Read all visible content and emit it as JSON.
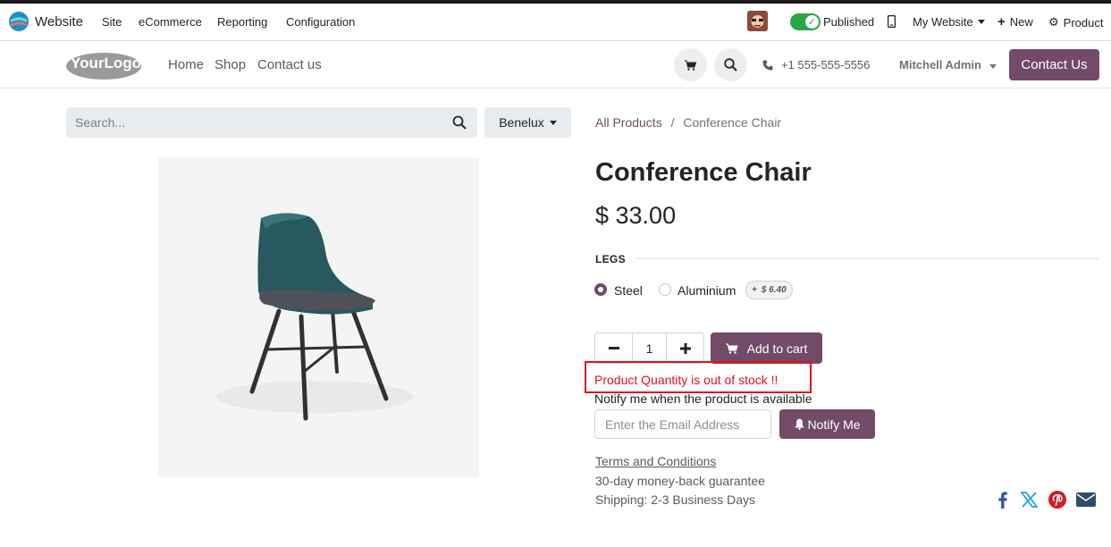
{
  "admin_bar": {
    "app_name": "Website",
    "menus": [
      "Site",
      "eCommerce",
      "Reporting",
      "Configuration"
    ],
    "published_label": "Published",
    "website_label": "My Website",
    "new_label": "New",
    "product_label": "Product"
  },
  "header": {
    "logo_text": "YourLogo",
    "nav": [
      "Home",
      "Shop",
      "Contact us"
    ],
    "phone": "+1 555-555-5556",
    "user": "Mitchell Admin",
    "contact_button": "Contact Us"
  },
  "search": {
    "placeholder": "Search..."
  },
  "pricelist": "Benelux",
  "breadcrumb": {
    "parent": "All Products",
    "separator": "/",
    "current": "Conference Chair"
  },
  "product": {
    "name": "Conference Chair",
    "price": "$ 33.00",
    "attribute_label": "LEGS",
    "options": [
      {
        "label": "Steel",
        "selected": true
      },
      {
        "label": "Aluminium",
        "selected": false,
        "extra": "$ 6.40",
        "extra_sign": "+"
      }
    ],
    "quantity": "1",
    "add_to_cart": "Add to cart",
    "stock_message": "Product Quantity is out of stock !!",
    "notify_text": "Notify me when the product is available",
    "email_placeholder": "Enter the Email Address",
    "notify_button": "Notify Me"
  },
  "info": {
    "terms": "Terms and Conditions",
    "guarantee": "30-day money-back guarantee",
    "shipping": "Shipping: 2-3 Business Days"
  },
  "colors": {
    "brand": "#714b67",
    "error": "#e0121a",
    "published": "#28a745"
  },
  "share_icons": [
    "facebook-icon",
    "x-icon",
    "pinterest-icon",
    "email-icon"
  ]
}
